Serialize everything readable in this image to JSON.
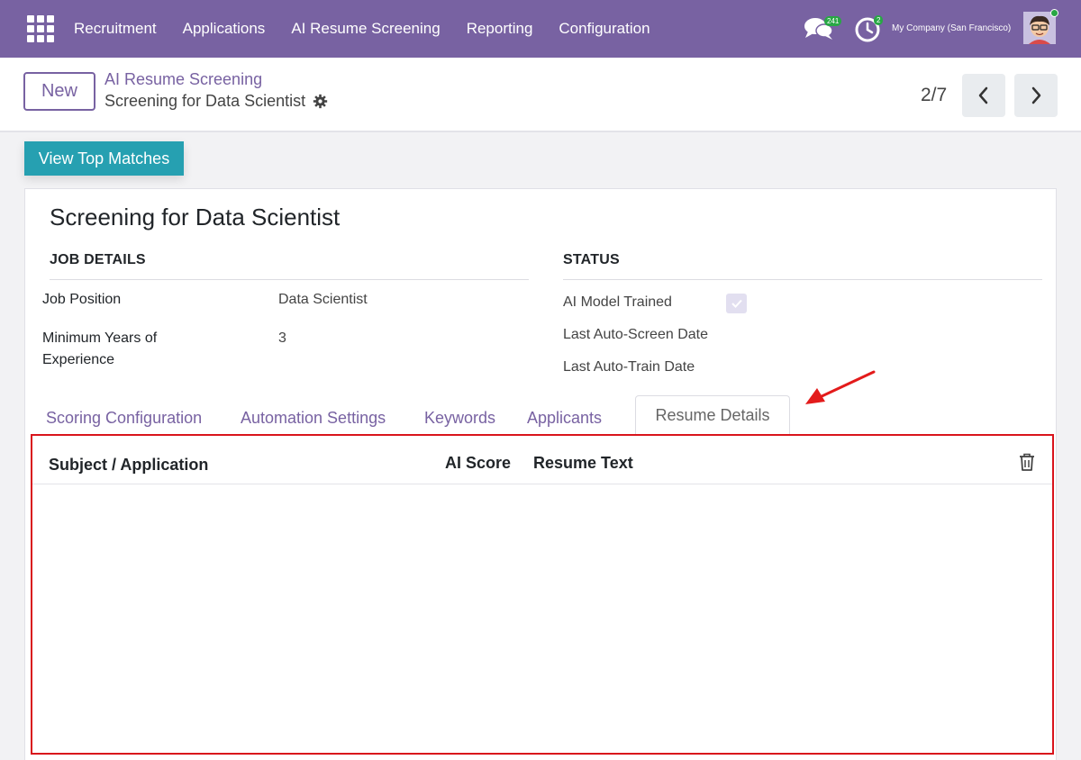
{
  "navbar": {
    "menu": [
      "Recruitment",
      "Applications",
      "AI Resume Screening",
      "Reporting",
      "Configuration"
    ],
    "messages_count": "241",
    "activities_count": "2",
    "company": "My Company (San Francisco)",
    "icons": {
      "apps": "grid-icon",
      "messages": "chat-icon",
      "activities": "clock-icon",
      "user": "avatar"
    },
    "color": "#7862a2"
  },
  "control_panel": {
    "new_label": "New",
    "breadcrumb_parent": "AI Resume Screening",
    "breadcrumb_current": "Screening for Data Scientist",
    "pager": "2/7"
  },
  "actions": {
    "view_top_matches": "View Top Matches",
    "color": "#26a0b1"
  },
  "form": {
    "title": "Screening for Data Scientist",
    "job_details": {
      "heading": "JOB DETAILS",
      "fields": [
        {
          "label": "Job Position",
          "value": "Data Scientist"
        },
        {
          "label": "Minimum Years of Experience",
          "value": "3"
        }
      ]
    },
    "status": {
      "heading": "STATUS",
      "ai_model_trained_label": "AI Model Trained",
      "ai_model_trained": true,
      "last_auto_screen_label": "Last Auto-Screen Date",
      "last_auto_train_label": "Last Auto-Train Date"
    }
  },
  "tabs": [
    "Scoring Configuration",
    "Automation Settings",
    "Keywords",
    "Applicants",
    "Resume Details"
  ],
  "active_tab": "Resume Details",
  "table": {
    "columns": [
      "Subject / Application",
      "AI Score",
      "Resume Text"
    ],
    "rows": []
  },
  "annotation": {
    "highlight_color": "#d9141c"
  }
}
